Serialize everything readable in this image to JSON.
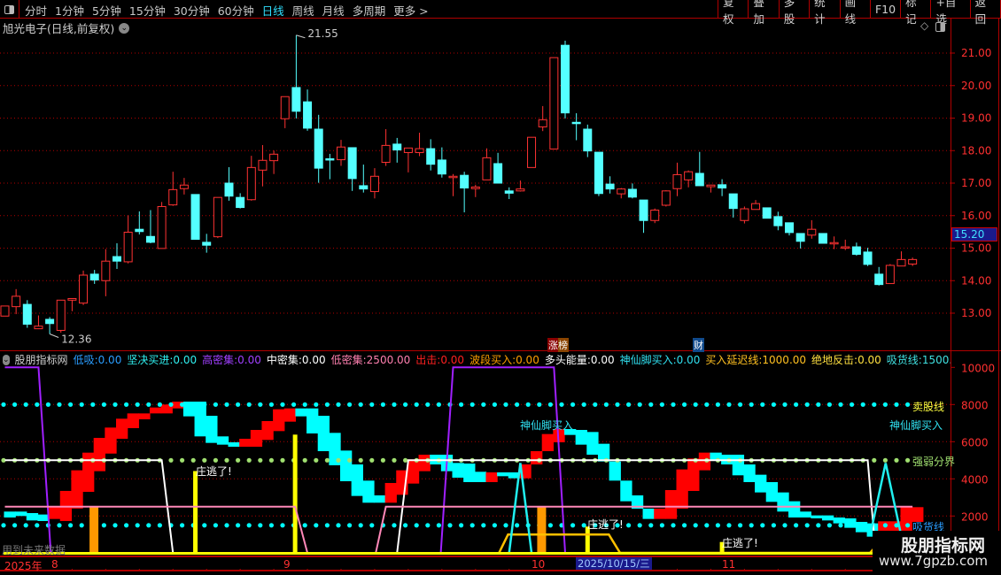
{
  "toolbar": {
    "tabs": [
      "分时",
      "1分钟",
      "5分钟",
      "15分钟",
      "30分钟",
      "60分钟",
      "日线",
      "周线",
      "月线",
      "多周期",
      "更多 >"
    ],
    "active_tab": "日线",
    "buttons": [
      "复权",
      "叠加",
      "多股",
      "统计",
      "画线",
      "F10",
      "标记",
      "+自选",
      "返回"
    ]
  },
  "title": "旭光电子(日线,前复权)",
  "price_axis": {
    "ticks": [
      "21.00",
      "20.00",
      "19.00",
      "18.00",
      "17.00",
      "16.00",
      "15.00",
      "14.00",
      "13.00"
    ],
    "tick_values": [
      21,
      20,
      19,
      18,
      17,
      16,
      15,
      14,
      13
    ],
    "current_price": "15.20",
    "current_value": 15.2
  },
  "annotations": {
    "high_label": "21.55",
    "high_index": 26,
    "low_label": "12.36",
    "low_index": 4,
    "badge_zhangbang": "涨榜",
    "badge_cai": "财"
  },
  "colors": {
    "up": "#ff3232",
    "down": "#54ffff",
    "grid": "#b00000"
  },
  "candles": [
    [
      12.91,
      13.22,
      12.91,
      13.22
    ],
    [
      13.2,
      13.74,
      12.97,
      13.52
    ],
    [
      13.27,
      13.4,
      12.55,
      12.66
    ],
    [
      12.52,
      12.93,
      12.52,
      12.6
    ],
    [
      12.81,
      12.88,
      12.36,
      12.68
    ],
    [
      12.47,
      13.4,
      12.4,
      13.4
    ],
    [
      13.4,
      13.45,
      13.06,
      13.45
    ],
    [
      13.31,
      14.31,
      13.25,
      14.17
    ],
    [
      14.2,
      14.33,
      13.9,
      14.02
    ],
    [
      14.0,
      14.97,
      13.52,
      14.6
    ],
    [
      14.74,
      15.15,
      14.36,
      14.6
    ],
    [
      14.58,
      16.01,
      14.53,
      15.49
    ],
    [
      15.58,
      16.13,
      15.42,
      15.51
    ],
    [
      15.36,
      16.17,
      15.15,
      15.18
    ],
    [
      14.99,
      16.42,
      14.99,
      16.28
    ],
    [
      16.33,
      17.35,
      16.3,
      16.8
    ],
    [
      16.83,
      17.16,
      16.65,
      16.94
    ],
    [
      16.65,
      16.65,
      15.27,
      15.27
    ],
    [
      15.18,
      15.44,
      14.86,
      15.09
    ],
    [
      15.35,
      16.56,
      15.31,
      16.56
    ],
    [
      17.0,
      17.49,
      16.46,
      16.6
    ],
    [
      16.56,
      16.69,
      16.22,
      16.25
    ],
    [
      16.49,
      17.84,
      16.46,
      17.48
    ],
    [
      17.4,
      18.17,
      16.9,
      17.7
    ],
    [
      17.69,
      18.0,
      17.28,
      17.89
    ],
    [
      18.98,
      19.66,
      18.69,
      19.66
    ],
    [
      19.94,
      21.55,
      18.99,
      19.21
    ],
    [
      19.5,
      19.88,
      18.61,
      18.69
    ],
    [
      18.66,
      19.1,
      17.01,
      17.46
    ],
    [
      17.75,
      17.9,
      17.12,
      17.72
    ],
    [
      17.72,
      18.33,
      17.53,
      18.11
    ],
    [
      18.09,
      18.1,
      16.76,
      17.14
    ],
    [
      16.92,
      17.57,
      16.71,
      16.82
    ],
    [
      16.74,
      17.46,
      16.53,
      17.21
    ],
    [
      17.64,
      18.66,
      17.53,
      18.16
    ],
    [
      18.2,
      18.39,
      17.63,
      18.02
    ],
    [
      17.94,
      18.08,
      17.33,
      18.08
    ],
    [
      17.94,
      18.55,
      17.83,
      18.06
    ],
    [
      18.06,
      18.35,
      17.39,
      17.58
    ],
    [
      17.71,
      18.1,
      17.17,
      17.28
    ],
    [
      17.17,
      17.28,
      16.6,
      17.21
    ],
    [
      17.24,
      17.35,
      16.1,
      16.85
    ],
    [
      16.83,
      16.95,
      16.57,
      16.88
    ],
    [
      17.1,
      18.07,
      17.1,
      17.78
    ],
    [
      17.6,
      17.93,
      17.0,
      17.0
    ],
    [
      16.76,
      16.87,
      16.51,
      16.69
    ],
    [
      16.76,
      17.08,
      16.74,
      16.82
    ],
    [
      17.48,
      18.41,
      17.48,
      18.41
    ],
    [
      18.73,
      19.37,
      18.6,
      18.95
    ],
    [
      18.05,
      20.86,
      18.05,
      20.86
    ],
    [
      21.24,
      21.38,
      18.99,
      19.16
    ],
    [
      18.87,
      19.15,
      18.32,
      18.84
    ],
    [
      18.66,
      18.8,
      17.8,
      17.99
    ],
    [
      17.95,
      17.95,
      16.6,
      16.68
    ],
    [
      16.97,
      17.21,
      16.68,
      16.82
    ],
    [
      16.67,
      16.85,
      16.53,
      16.82
    ],
    [
      16.81,
      16.99,
      16.53,
      16.57
    ],
    [
      16.48,
      16.48,
      15.47,
      15.85
    ],
    [
      15.85,
      16.22,
      15.77,
      16.17
    ],
    [
      16.32,
      16.78,
      16.28,
      16.76
    ],
    [
      16.83,
      17.63,
      16.6,
      17.26
    ],
    [
      17.1,
      17.39,
      16.87,
      17.35
    ],
    [
      17.3,
      17.96,
      16.92,
      16.92
    ],
    [
      16.89,
      16.94,
      16.71,
      16.94
    ],
    [
      16.95,
      17.12,
      16.6,
      16.85
    ],
    [
      16.67,
      16.67,
      15.94,
      16.22
    ],
    [
      15.85,
      16.28,
      15.76,
      16.21
    ],
    [
      16.19,
      16.48,
      16.19,
      16.37
    ],
    [
      16.24,
      16.24,
      15.92,
      15.92
    ],
    [
      15.97,
      16.12,
      15.55,
      15.69
    ],
    [
      15.78,
      15.78,
      15.39,
      15.48
    ],
    [
      15.45,
      15.45,
      14.99,
      15.21
    ],
    [
      15.4,
      15.86,
      15.29,
      15.58
    ],
    [
      15.45,
      15.45,
      15.15,
      15.15
    ],
    [
      15.14,
      15.36,
      14.97,
      15.17
    ],
    [
      15.01,
      15.26,
      14.94,
      15.04
    ],
    [
      15.04,
      15.17,
      14.77,
      14.81
    ],
    [
      14.88,
      15.01,
      14.45,
      14.5
    ],
    [
      14.2,
      14.42,
      13.85,
      13.88
    ],
    [
      13.91,
      14.51,
      13.91,
      14.47
    ],
    [
      14.45,
      14.9,
      14.45,
      14.65
    ],
    [
      14.51,
      14.71,
      14.45,
      14.65
    ]
  ],
  "indicator": {
    "name": "股朋指标网",
    "values": [
      {
        "label": "低吸:",
        "value": "0.00",
        "color": "#2a9dff"
      },
      {
        "label": "坚决买进:",
        "value": "0.00",
        "color": "#30f0f0"
      },
      {
        "label": "高密集:",
        "value": "0.00",
        "color": "#a040ff"
      },
      {
        "label": "中密集:",
        "value": "0.00",
        "color": "#ffffff"
      },
      {
        "label": "低密集:",
        "value": "2500.00",
        "color": "#ff80b0"
      },
      {
        "label": "出击:",
        "value": "0.00",
        "color": "#ff2020"
      },
      {
        "label": "波段买入:",
        "value": "0.00",
        "color": "#ffa000"
      },
      {
        "label": "多头能量:",
        "value": "0.00",
        "color": "#ffffff"
      },
      {
        "label": "神仙脚买入:",
        "value": "0.00",
        "color": "#30e0f0"
      },
      {
        "label": "买入延迟线:",
        "value": "1000.00",
        "color": "#ffc020"
      },
      {
        "label": "绝地反击:",
        "value": "0.00",
        "color": "#ffe040"
      },
      {
        "label": "吸货线:",
        "value": "1500.00",
        "color": "#40e0e0"
      }
    ],
    "axis_ticks": [
      "10000",
      "8000",
      "6000",
      "4000",
      "2000"
    ],
    "axis_values": [
      10000,
      8000,
      6000,
      4000,
      2000
    ],
    "levels": {
      "sell_line": 8000,
      "strong_weak": 5000,
      "accumulate": 1500
    },
    "labels": {
      "sell": "卖股线",
      "fairy_buy": "神仙脚买入",
      "strong_weak": "强弱分界",
      "accumulate": "吸货线",
      "escape": "庄逃了!",
      "future": "用到未来数据"
    },
    "ribbon": [
      [
        1920,
        2238,
        "c"
      ],
      [
        2000,
        2238,
        "c"
      ],
      [
        1760,
        2158,
        "c"
      ],
      [
        1730,
        2080,
        "c"
      ],
      [
        1840,
        2476,
        "r"
      ],
      [
        1730,
        3350,
        "r"
      ],
      [
        2400,
        4460,
        "r"
      ],
      [
        3300,
        5410,
        "r"
      ],
      [
        4412,
        6205,
        "r"
      ],
      [
        5360,
        6760,
        "r"
      ],
      [
        6157,
        7237,
        "r"
      ],
      [
        6730,
        7522,
        "r"
      ],
      [
        7205,
        7522,
        "r"
      ],
      [
        7522,
        7840,
        "r"
      ],
      [
        7522,
        8000,
        "r"
      ],
      [
        7792,
        8157,
        "r"
      ],
      [
        7364,
        8157,
        "c"
      ],
      [
        6285,
        8157,
        "c"
      ],
      [
        5935,
        7395,
        "c"
      ],
      [
        5840,
        6285,
        "c"
      ],
      [
        5729,
        5967,
        "c"
      ],
      [
        5729,
        6157,
        "r"
      ],
      [
        5729,
        6633,
        "r"
      ],
      [
        6094,
        7110,
        "r"
      ],
      [
        6570,
        7745,
        "r"
      ],
      [
        7078,
        7792,
        "r"
      ],
      [
        7364,
        7792,
        "c"
      ],
      [
        6443,
        7792,
        "c"
      ],
      [
        5490,
        7395,
        "c"
      ],
      [
        4730,
        6475,
        "c"
      ],
      [
        3872,
        5522,
        "c"
      ],
      [
        3079,
        4777,
        "c"
      ],
      [
        2714,
        3904,
        "c"
      ],
      [
        2714,
        3110,
        "c"
      ],
      [
        2714,
        3777,
        "r"
      ],
      [
        3142,
        4460,
        "r"
      ],
      [
        3745,
        5047,
        "r"
      ],
      [
        4412,
        5300,
        "r"
      ],
      [
        4777,
        5300,
        "c"
      ],
      [
        4412,
        5300,
        "c"
      ],
      [
        4063,
        4856,
        "c"
      ],
      [
        3825,
        4825,
        "c"
      ],
      [
        3825,
        4380,
        "c"
      ],
      [
        3825,
        4348,
        "r"
      ],
      [
        4142,
        4348,
        "c"
      ],
      [
        4030,
        4348,
        "c"
      ],
      [
        4030,
        4777,
        "r"
      ],
      [
        4777,
        5490,
        "r"
      ],
      [
        5490,
        6412,
        "r"
      ],
      [
        5967,
        6681,
        "r"
      ],
      [
        6364,
        6681,
        "c"
      ],
      [
        5840,
        6633,
        "c"
      ],
      [
        5300,
        6522,
        "c"
      ],
      [
        4936,
        5888,
        "c"
      ],
      [
        3904,
        4936,
        "c"
      ],
      [
        2793,
        3904,
        "c"
      ],
      [
        2396,
        3110,
        "c"
      ],
      [
        1841,
        2396,
        "c"
      ],
      [
        1841,
        2396,
        "r"
      ],
      [
        1841,
        3396,
        "r"
      ],
      [
        2396,
        4507,
        "r"
      ],
      [
        3348,
        5095,
        "r"
      ],
      [
        4460,
        5412,
        "r"
      ],
      [
        5015,
        5412,
        "c"
      ],
      [
        4777,
        5300,
        "c"
      ],
      [
        4190,
        5300,
        "c"
      ],
      [
        3825,
        4777,
        "c"
      ],
      [
        3269,
        4222,
        "c"
      ],
      [
        2761,
        3825,
        "c"
      ],
      [
        2238,
        3269,
        "c"
      ],
      [
        1920,
        2793,
        "c"
      ],
      [
        1920,
        2238,
        "c"
      ],
      [
        1873,
        2032,
        "c"
      ],
      [
        1761,
        2032,
        "c"
      ],
      [
        1603,
        1920,
        "c"
      ],
      [
        1365,
        1873,
        "c"
      ],
      [
        1127,
        1682,
        "c"
      ],
      [
        888,
        1603,
        "c"
      ],
      [
        1206,
        1714,
        "r"
      ],
      [
        1127,
        1714,
        "r"
      ],
      [
        1206,
        2476,
        "r"
      ],
      [
        1682,
        2476,
        "r"
      ]
    ],
    "lines": [
      {
        "name": "high-density-line",
        "color": "#a020ff",
        "points": [
          [
            0,
            10000
          ],
          [
            3,
            10000
          ],
          [
            4.1,
            0
          ],
          [
            38.9,
            0
          ],
          [
            40,
            10000
          ],
          [
            49,
            10000
          ],
          [
            50,
            0
          ],
          [
            81,
            0
          ]
        ]
      },
      {
        "name": "mid-density-line",
        "color": "#ffffff",
        "points": [
          [
            0,
            5000
          ],
          [
            14,
            5000
          ],
          [
            15,
            0
          ],
          [
            35,
            0
          ],
          [
            36,
            5000
          ],
          [
            77,
            5000
          ],
          [
            77.7,
            0
          ],
          [
            81,
            0
          ]
        ]
      },
      {
        "name": "low-density-line",
        "color": "#ff88b8",
        "points": [
          [
            0,
            2500
          ],
          [
            25.9,
            2500
          ],
          [
            27,
            0
          ],
          [
            33.1,
            0
          ],
          [
            34,
            2500
          ],
          [
            81,
            2500
          ]
        ]
      },
      {
        "name": "buy-delay-line",
        "color": "#ffc000",
        "points": [
          [
            44.1,
            0
          ],
          [
            44.9,
            1000
          ],
          [
            53.9,
            1000
          ],
          [
            54.9,
            0
          ],
          [
            77.2,
            0
          ],
          [
            77.8,
            400
          ]
        ]
      },
      {
        "name": "fairy-foot-line",
        "color": "#20f0f0",
        "points": [
          [
            45,
            0
          ],
          [
            46,
            4850
          ],
          [
            47,
            0
          ]
        ]
      },
      {
        "name": "fairy-foot-line-2",
        "color": "#20f0f0",
        "points": [
          [
            77.3,
            1200
          ],
          [
            78.6,
            4850
          ],
          [
            79.9,
            1200
          ]
        ]
      }
    ],
    "attack_bars": [
      [
        17,
        4420
      ],
      [
        25.9,
        6380
      ],
      [
        52,
        1430
      ],
      [
        64,
        600
      ]
    ],
    "band_buy_bars": [
      [
        7.95,
        2500
      ],
      [
        47.9,
        2500
      ]
    ]
  },
  "date_axis": {
    "year": "2025年",
    "months": [
      "8",
      "9",
      "10",
      "11"
    ],
    "selected": "2025/10/15/三"
  },
  "watermark": {
    "name": "股朋指标网",
    "url": "www.7gpzb.com"
  }
}
